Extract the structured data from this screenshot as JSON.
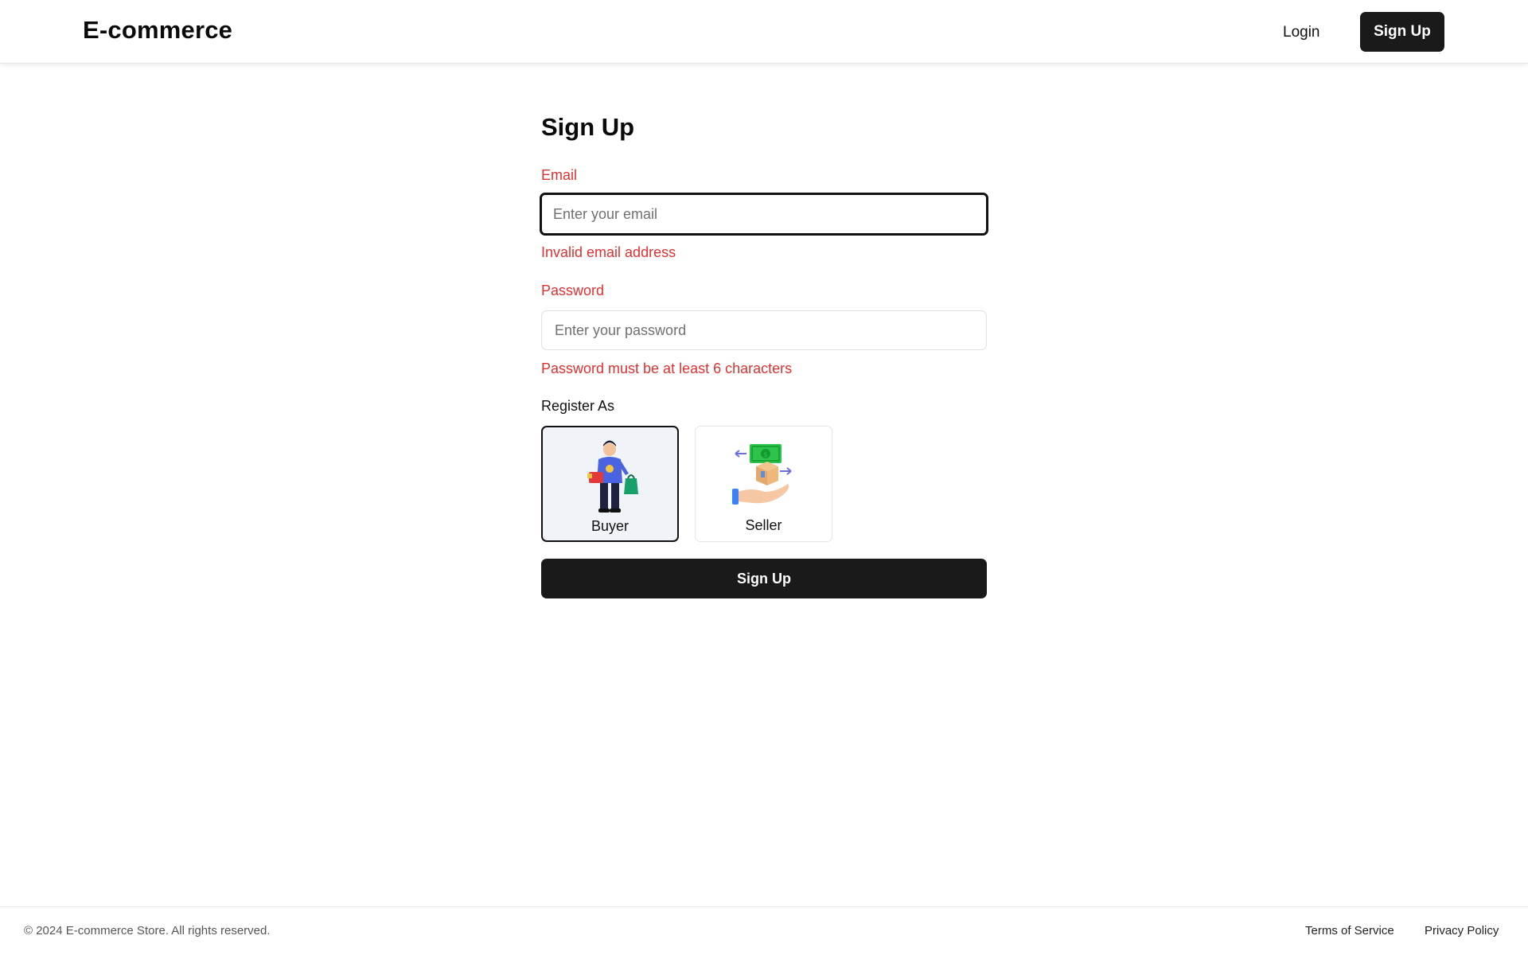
{
  "header": {
    "brand": "E-commerce",
    "login_label": "Login",
    "signup_label": "Sign Up"
  },
  "form": {
    "title": "Sign Up",
    "email": {
      "label": "Email",
      "placeholder": "Enter your email",
      "value": "",
      "error": "Invalid email address"
    },
    "password": {
      "label": "Password",
      "placeholder": "Enter your password",
      "value": "",
      "error": "Password must be at least 6 characters"
    },
    "register_as": {
      "label": "Register As",
      "options": [
        {
          "label": "Buyer",
          "icon": "buyer-illustration",
          "selected": true
        },
        {
          "label": "Seller",
          "icon": "seller-illustration",
          "selected": false
        }
      ]
    },
    "submit_label": "Sign Up"
  },
  "footer": {
    "copyright": "© 2024 E-commerce Store. All rights reserved.",
    "links": [
      "Terms of Service",
      "Privacy Policy"
    ]
  },
  "colors": {
    "error": "#e03131",
    "primary_button": "#1a1a1a",
    "selected_card_bg": "#f0f3f8"
  }
}
